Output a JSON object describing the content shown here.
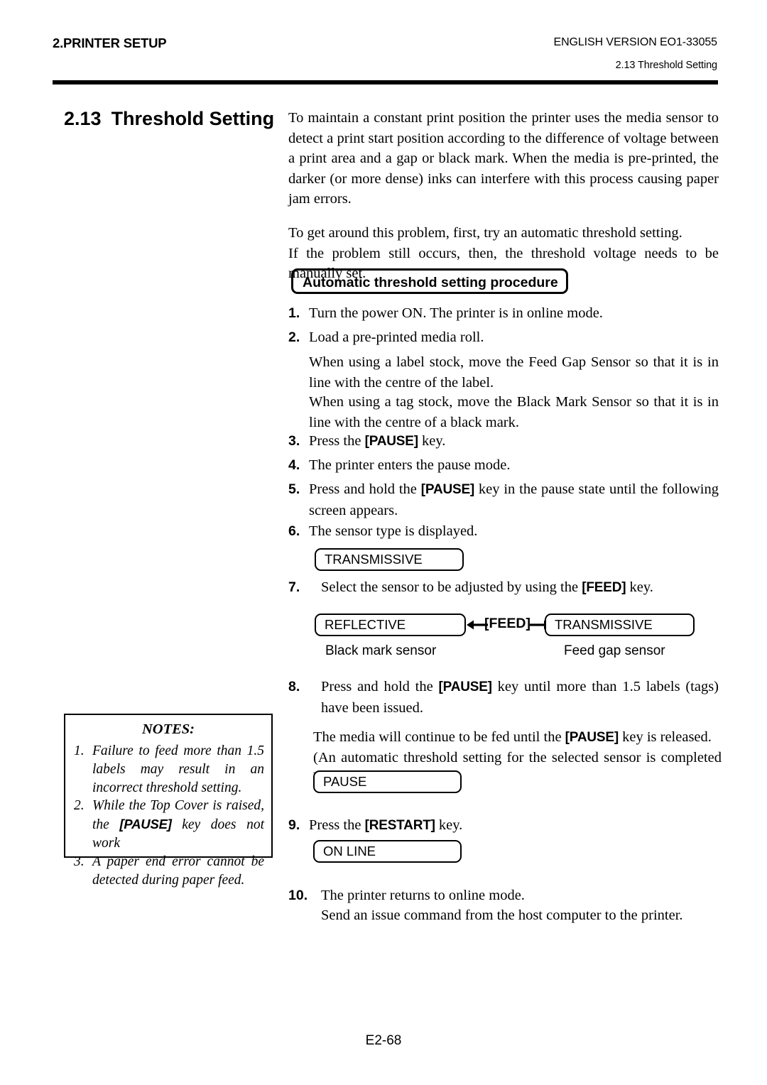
{
  "header": {
    "left_title": "2.PRINTER SETUP",
    "right_version": "ENGLISH VERSION EO1-33055",
    "right_section": "2.13 Threshold Setting"
  },
  "section": {
    "number": "2.13",
    "title": "Threshold Setting"
  },
  "intro": {
    "paragraph_1": "To maintain a constant print position the printer uses the media sensor to detect a print start position according to the difference of voltage between a print area and a gap or black mark.  When the media is pre-printed, the darker (or more dense) inks can interfere with this process causing paper jam errors.",
    "paragraph_2_line_1": "To get around this problem, first, try an automatic threshold setting.",
    "paragraph_2_line_2": "If the problem still occurs, then, the threshold voltage needs to be manually set."
  },
  "procedure": {
    "heading": "Automatic threshold setting procedure",
    "steps": [
      {
        "number": "1.",
        "text_before": "Turn the power ON.  The printer is in online mode.",
        "key": "",
        "text_after": ""
      },
      {
        "number": "2.",
        "text_before": "Load a pre-printed media roll.",
        "key": "",
        "text_after": ""
      },
      {
        "number": "3.",
        "text_before": "Press the ",
        "key": "[PAUSE]",
        "text_after": " key."
      },
      {
        "number": "4.",
        "text_before": "The printer enters the pause mode.",
        "key": "",
        "text_after": ""
      },
      {
        "number": "5.",
        "text_before": "Press and hold the ",
        "key": "[PAUSE]",
        "text_after": " key in the pause state until the following screen appears."
      },
      {
        "number": "6.",
        "text_before": "The sensor type is displayed.",
        "key": "",
        "text_after": ""
      },
      {
        "number": "7.",
        "text_before": "Select the sensor to be adjusted by using the ",
        "key": "[FEED]",
        "text_after": " key."
      },
      {
        "number": "8.",
        "text_before": "Press and hold the ",
        "key": "[PAUSE]",
        "text_after": " key until more than 1.5 labels (tags) have been issued."
      },
      {
        "number": "9.",
        "text_before": "Press the ",
        "key": "[RESTART]",
        "text_after": " key."
      },
      {
        "number": "10.",
        "text_before": "The printer returns to online mode.",
        "key": "",
        "text_after": ""
      }
    ],
    "step2_sub_1": "When using a label stock, move the Feed Gap Sensor so that it is in line with the centre of the label.",
    "step2_sub_2": "When using a tag stock, move the Black Mark Sensor so that it is in line with the centre of a black mark.",
    "step8_sub_1_before": "The media will continue to be fed until the ",
    "step8_sub_1_key": "[PAUSE]",
    "step8_sub_1_after": " key is released.",
    "step8_sub_2": "(An automatic threshold setting for the selected sensor is completed by this operation.)",
    "step10_sub": "Send an issue command from the host computer to the printer."
  },
  "displays": {
    "transmissive_1": "TRANSMISSIVE",
    "reflective": "REFLECTIVE",
    "transmissive_2": "TRANSMISSIVE",
    "pause": "PAUSE",
    "online": "ON LINE"
  },
  "selector": {
    "feed_key": "[FEED]",
    "left_caption": "Black mark sensor",
    "right_caption": "Feed gap sensor"
  },
  "notes": {
    "title": "NOTES:",
    "items": [
      {
        "number": "1.",
        "text_before": "Failure to feed more than 1.5 labels may result in an incorrect threshold setting.",
        "key": "",
        "text_after": ""
      },
      {
        "number": "2.",
        "text_before": "While the Top Cover is raised, the ",
        "key": "[PAUSE]",
        "text_after": " key does not work"
      },
      {
        "number": "3.",
        "text_before": "A paper end error cannot be detected during paper feed.",
        "key": "",
        "text_after": ""
      }
    ]
  },
  "footer": {
    "page": "E2-68"
  },
  "colors": {
    "ink": "#000000",
    "paper": "#ffffff"
  }
}
